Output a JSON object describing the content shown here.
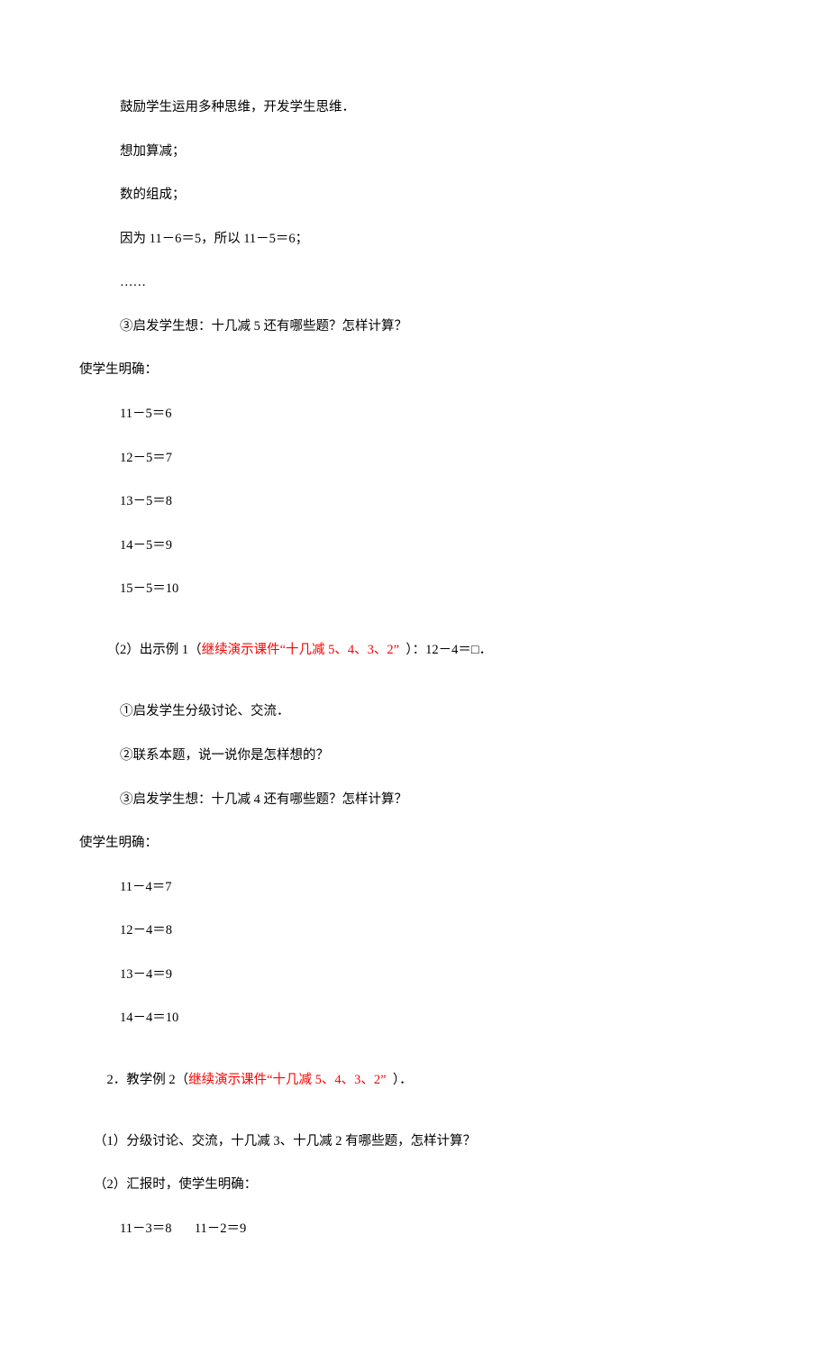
{
  "lines": {
    "l01": "鼓励学生运用多种思维，开发学生思维．",
    "l02": "想加算减；",
    "l03": "数的组成；",
    "l04": "因为 11－6＝5，所以 11－5＝6；",
    "l05": "……",
    "l06": "③启发学生想：十几减 5 还有哪些题？怎样计算？",
    "l07": "使学生明确：",
    "l08": "11－5＝6",
    "l09": "12－5＝7",
    "l10": "13－5＝8",
    "l11": "14－5＝9",
    "l12": "15－5＝10",
    "l13a": "（2）出示例 1（",
    "l13b": "继续演示课件“十几减 5、4、3、2”",
    "l13c": "  ）：12－4＝□．",
    "l14": "①启发学生分级讨论、交流．",
    "l15": "②联系本题，说一说你是怎样想的？",
    "l16": "③启发学生想：十几减 4 还有哪些题？怎样计算？",
    "l17": "使学生明确：",
    "l18": "11－4＝7",
    "l19": "12－4＝8",
    "l20": "13－4＝9",
    "l21": "14－4＝10",
    "l22a": "2．教学例 2（",
    "l22b": "继续演示课件“十几减 5、4、3、2”",
    "l22c": "  ）．",
    "l23": "（1）分级讨论、交流，十几减 3、十几减 2 有哪些题，怎样计算？",
    "l24": "（2）汇报时，使学生明确：",
    "l25": "11－3＝8       11－2＝9"
  }
}
